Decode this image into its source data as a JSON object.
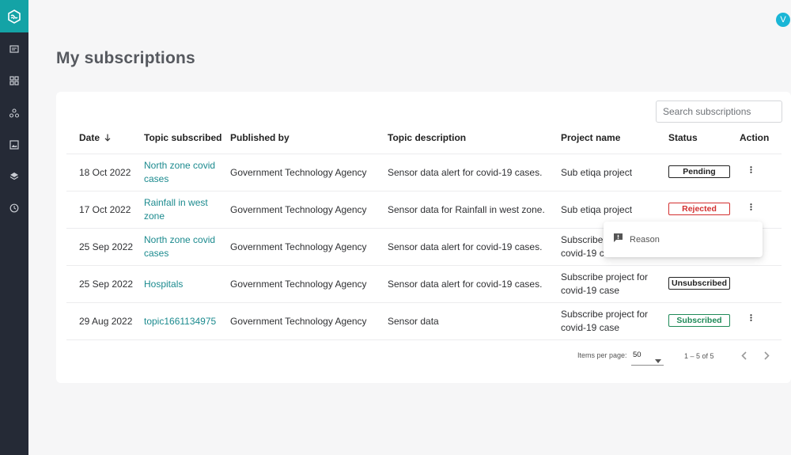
{
  "app": {
    "avatar_initial": "V",
    "accent_color": "#14a3a6",
    "sidebar_icons": [
      "logo-icon",
      "subscriptions-icon",
      "dashboard-icon",
      "network-icon",
      "image-icon",
      "layers-icon",
      "history-icon"
    ]
  },
  "page": {
    "title": "My subscriptions"
  },
  "search": {
    "placeholder": "Search subscriptions"
  },
  "table": {
    "headers": {
      "date": "Date",
      "topic": "Topic subscribed",
      "publisher": "Published by",
      "description": "Topic description",
      "project": "Project name",
      "status": "Status",
      "action": "Action"
    },
    "sort_icon": "arrow-down-icon",
    "rows": [
      {
        "date": "18 Oct 2022",
        "topic": "North zone covid cases",
        "publisher": "Government Technology Agency",
        "description": "Sensor data alert for covid-19 cases.",
        "project": "Sub etiqa project",
        "status": "Pending",
        "has_action": true
      },
      {
        "date": "17 Oct 2022",
        "topic": "Rainfall in west zone",
        "publisher": "Government Technology Agency",
        "description": "Sensor data for Rainfall in west zone.",
        "project": "Sub etiqa project",
        "status": "Rejected",
        "has_action": true
      },
      {
        "date": "25 Sep 2022",
        "topic": "North zone covid cases",
        "publisher": "Government Technology Agency",
        "description": "Sensor data alert for covid-19 cases.",
        "project": "Subscribe project for covid-19 case",
        "status": "",
        "has_action": false
      },
      {
        "date": "25 Sep 2022",
        "topic": "Hospitals",
        "publisher": "Government Technology Agency",
        "description": "Sensor data alert for covid-19 cases.",
        "project": "Subscribe project for covid-19 case",
        "status": "Unsubscribed",
        "has_action": false
      },
      {
        "date": "29 Aug 2022",
        "topic": "topic1661134975",
        "publisher": "Government Technology Agency",
        "description": "Sensor data",
        "project": "Subscribe project for covid-19 case",
        "status": "Subscribed",
        "has_action": true
      }
    ]
  },
  "menu": {
    "item_label": "Reason",
    "item_icon": "feedback-icon"
  },
  "paginator": {
    "items_per_page_label": "Items per page:",
    "page_size": "50",
    "range": "1 – 5 of 5"
  }
}
